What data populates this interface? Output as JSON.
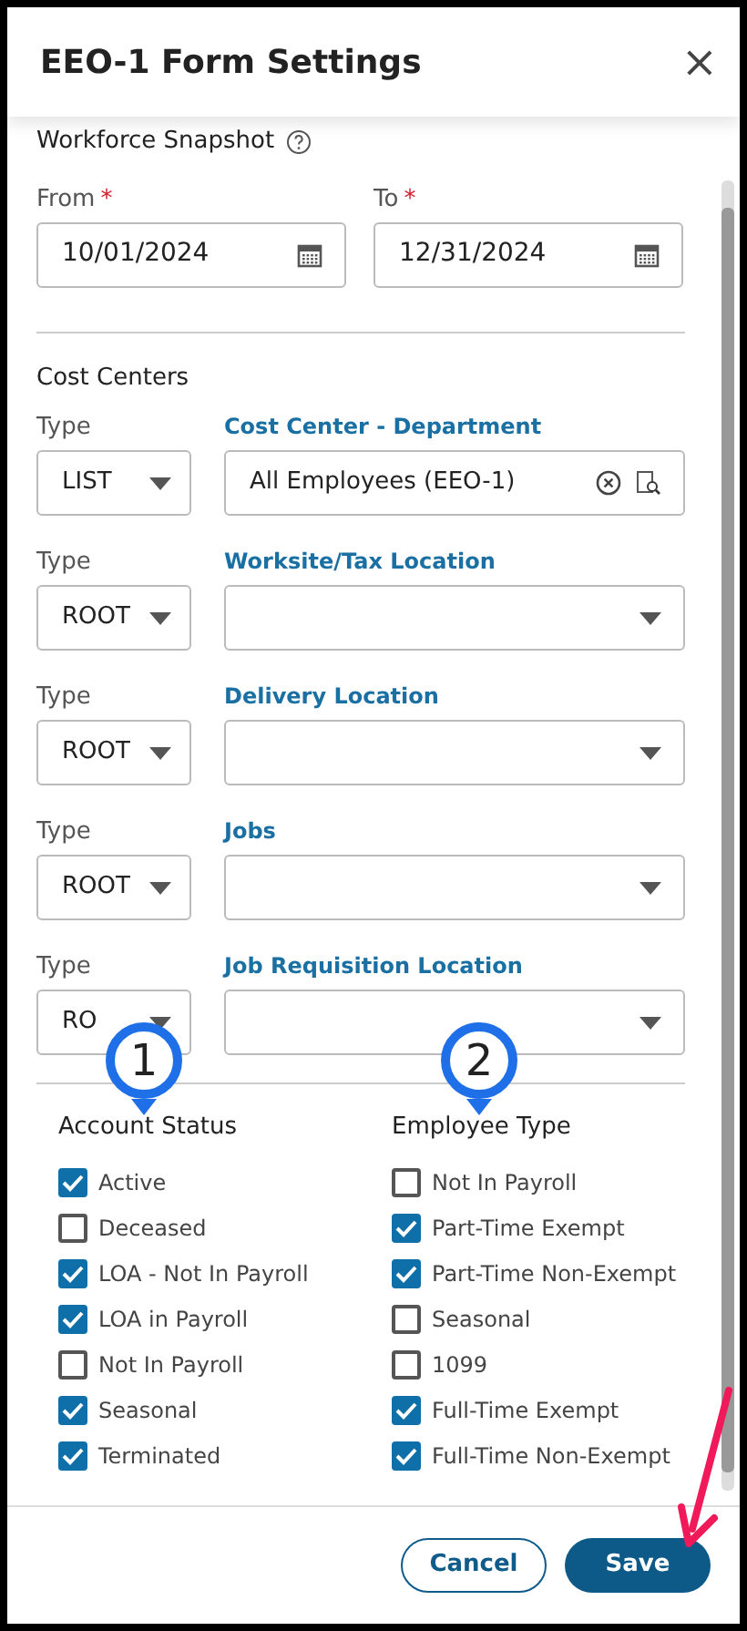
{
  "dialog": {
    "title": "EEO-1 Form Settings",
    "close": "×"
  },
  "snapshot": {
    "title": "Workforce Snapshot",
    "from": {
      "label": "From",
      "required_mark": "*",
      "value": "10/01/2024"
    },
    "to": {
      "label": "To",
      "required_mark": "*",
      "value": "12/31/2024"
    }
  },
  "cost_centers": {
    "title": "Cost Centers",
    "rows": [
      {
        "type_label": "Type",
        "type_value": "LIST",
        "label": "Cost Center - Department",
        "value": "All Employees (EEO-1)",
        "kind": "lookup"
      },
      {
        "type_label": "Type",
        "type_value": "ROOT",
        "label": "Worksite/Tax Location",
        "kind": "select"
      },
      {
        "type_label": "Type",
        "type_value": "ROOT",
        "label": "Delivery Location",
        "kind": "select"
      },
      {
        "type_label": "Type",
        "type_value": "ROOT",
        "label": "Jobs",
        "kind": "select"
      },
      {
        "type_label": "Type",
        "type_value": "RO",
        "label": "Job Requisition Location",
        "kind": "select"
      }
    ]
  },
  "callouts": [
    "1",
    "2"
  ],
  "groups": [
    {
      "title": "Account Status",
      "items": [
        {
          "label": "Active",
          "checked": true
        },
        {
          "label": "Deceased",
          "checked": false
        },
        {
          "label": "LOA - Not In Payroll",
          "checked": true
        },
        {
          "label": "LOA in Payroll",
          "checked": true
        },
        {
          "label": "Not In Payroll",
          "checked": false
        },
        {
          "label": "Seasonal",
          "checked": true
        },
        {
          "label": "Terminated",
          "checked": true
        }
      ]
    },
    {
      "title": "Employee Type",
      "items": [
        {
          "label": "Not In Payroll",
          "checked": false
        },
        {
          "label": "Part-Time Exempt",
          "checked": true
        },
        {
          "label": "Part-Time Non-Exempt",
          "checked": true
        },
        {
          "label": "Seasonal",
          "checked": false
        },
        {
          "label": "1099",
          "checked": false
        },
        {
          "label": "Full-Time Exempt",
          "checked": true
        },
        {
          "label": "Full-Time Non-Exempt",
          "checked": true
        }
      ]
    }
  ],
  "buttons": {
    "cancel": "Cancel",
    "save": "Save"
  }
}
